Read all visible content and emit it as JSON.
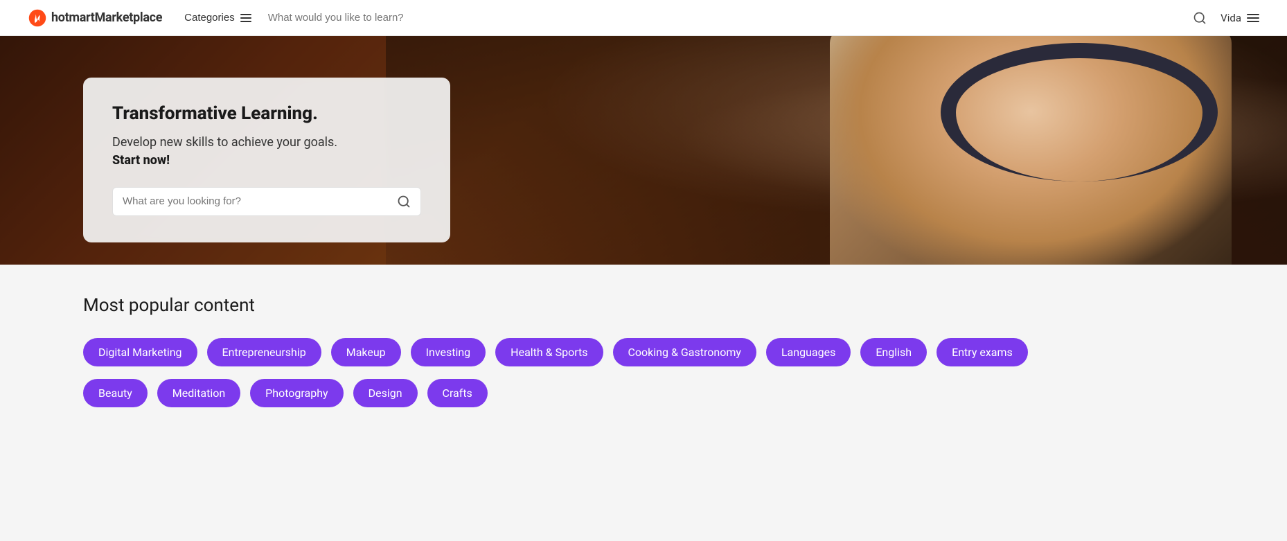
{
  "navbar": {
    "logo_brand": "hotmart",
    "logo_suffix": "Marketplace",
    "categories_label": "Categories",
    "search_placeholder": "What would you like to learn?",
    "user_name": "Vida"
  },
  "hero": {
    "title": "Transformative Learning.",
    "subtitle_line1": "Develop new skills to achieve your goals.",
    "subtitle_line2": "Start now!",
    "search_placeholder": "What are you looking for?"
  },
  "popular": {
    "section_title": "Most popular content",
    "tags_row1": [
      {
        "id": "digital-marketing",
        "label": "Digital Marketing"
      },
      {
        "id": "entrepreneurship",
        "label": "Entrepreneurship"
      },
      {
        "id": "makeup",
        "label": "Makeup"
      },
      {
        "id": "investing",
        "label": "Investing"
      },
      {
        "id": "health-sports",
        "label": "Health & Sports"
      },
      {
        "id": "cooking-gastronomy",
        "label": "Cooking & Gastronomy"
      },
      {
        "id": "languages",
        "label": "Languages"
      },
      {
        "id": "english",
        "label": "English"
      },
      {
        "id": "entry-exams",
        "label": "Entry exams"
      }
    ],
    "tags_row2": [
      {
        "id": "beauty",
        "label": "Beauty"
      },
      {
        "id": "meditation",
        "label": "Meditation"
      },
      {
        "id": "photography",
        "label": "Photography"
      },
      {
        "id": "design",
        "label": "Design"
      },
      {
        "id": "crafts",
        "label": "Crafts"
      }
    ]
  }
}
